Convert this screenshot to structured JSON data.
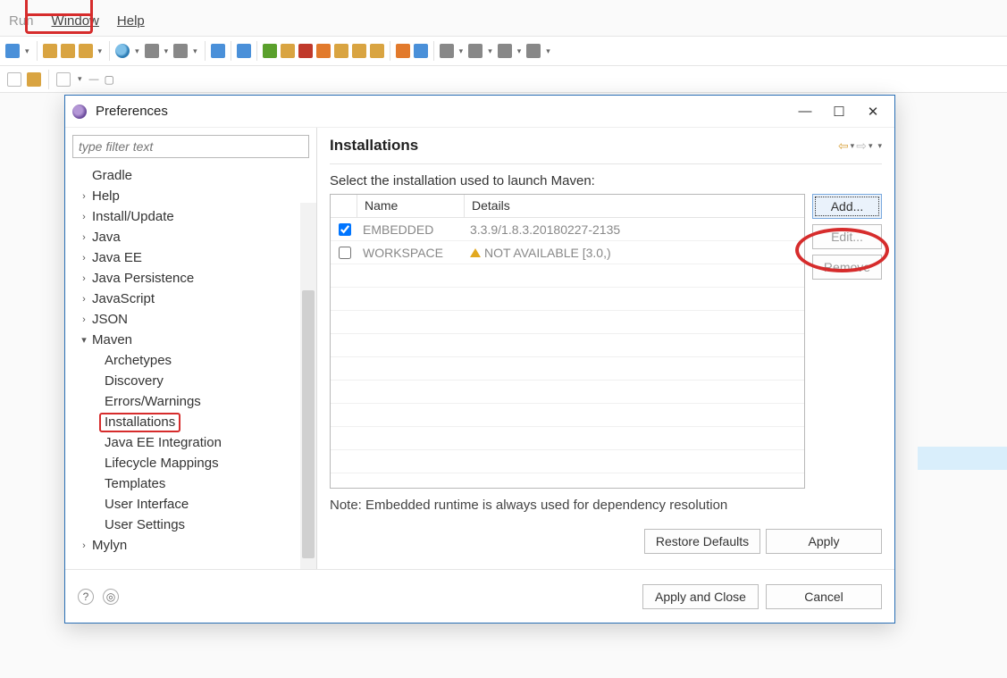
{
  "menu": {
    "run": "Run",
    "window": "Window",
    "help": "Help"
  },
  "dialog": {
    "title": "Preferences",
    "filter_placeholder": "type filter text",
    "page_title": "Installations",
    "prompt": "Select the installation used to launch Maven:",
    "note": "Note: Embedded runtime is always used for dependency resolution",
    "buttons": {
      "add": "Add...",
      "edit": "Edit...",
      "remove": "Remove",
      "restore_defaults": "Restore Defaults",
      "apply": "Apply",
      "apply_and_close": "Apply and Close",
      "cancel": "Cancel"
    },
    "table": {
      "col_name": "Name",
      "col_details": "Details",
      "rows": [
        {
          "checked": true,
          "name": "EMBEDDED",
          "details": "3.3.9/1.8.3.20180227-2135",
          "warn": false
        },
        {
          "checked": false,
          "name": "WORKSPACE",
          "details": "NOT AVAILABLE [3.0,)",
          "warn": true
        }
      ]
    },
    "tree": [
      {
        "label": "Gradle",
        "expandable": false
      },
      {
        "label": "Help",
        "expandable": true
      },
      {
        "label": "Install/Update",
        "expandable": true
      },
      {
        "label": "Java",
        "expandable": true
      },
      {
        "label": "Java EE",
        "expandable": true
      },
      {
        "label": "Java Persistence",
        "expandable": true
      },
      {
        "label": "JavaScript",
        "expandable": true
      },
      {
        "label": "JSON",
        "expandable": true
      },
      {
        "label": "Maven",
        "expandable": true,
        "expanded": true,
        "children": [
          {
            "label": "Archetypes"
          },
          {
            "label": "Discovery"
          },
          {
            "label": "Errors/Warnings"
          },
          {
            "label": "Installations",
            "selected": true
          },
          {
            "label": "Java EE Integration"
          },
          {
            "label": "Lifecycle Mappings"
          },
          {
            "label": "Templates"
          },
          {
            "label": "User Interface"
          },
          {
            "label": "User Settings"
          }
        ]
      },
      {
        "label": "Mylyn",
        "expandable": true
      }
    ]
  }
}
